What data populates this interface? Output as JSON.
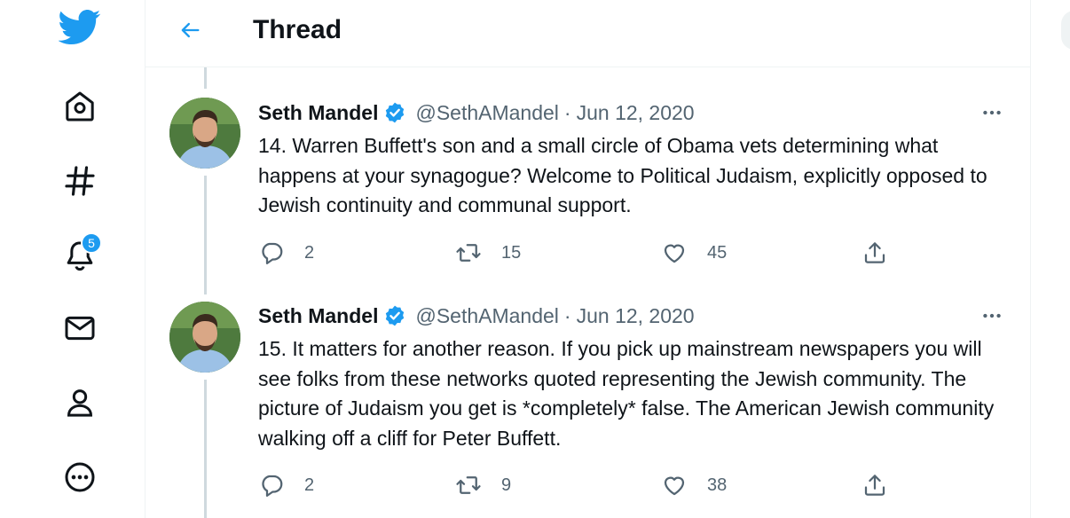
{
  "header": {
    "title": "Thread"
  },
  "nav": {
    "notification_count": "5"
  },
  "tweets": [
    {
      "name": "Seth Mandel",
      "handle": "@SethAMandel",
      "dot": "·",
      "date": "Jun 12, 2020",
      "text": "14. Warren Buffett's son and a small circle of Obama vets determining what happens at your synagogue? Welcome to Political Judaism, explicitly opposed to Jewish continuity and communal support.",
      "replies": "2",
      "retweets": "15",
      "likes": "45"
    },
    {
      "name": "Seth Mandel",
      "handle": "@SethAMandel",
      "dot": "·",
      "date": "Jun 12, 2020",
      "text": "15. It matters for another reason. If you pick up mainstream newspapers you will see folks from these networks quoted representing the Jewish community. The picture of Judaism you get is *completely* false. The American Jewish community walking off a cliff for Peter Buffett.",
      "replies": "2",
      "retweets": "9",
      "likes": "38"
    }
  ],
  "colors": {
    "brand": "#1d9bf0",
    "text": "#0f1419",
    "muted": "#536471",
    "thread_line": "#cfd9de"
  },
  "icons": [
    "twitter-logo-icon",
    "home-icon",
    "explore-hashtag-icon",
    "notifications-bell-icon",
    "messages-envelope-icon",
    "profile-icon",
    "more-circle-icon",
    "back-arrow-icon",
    "verified-badge-icon",
    "more-dots-icon",
    "reply-icon",
    "retweet-icon",
    "like-heart-icon",
    "share-icon"
  ]
}
